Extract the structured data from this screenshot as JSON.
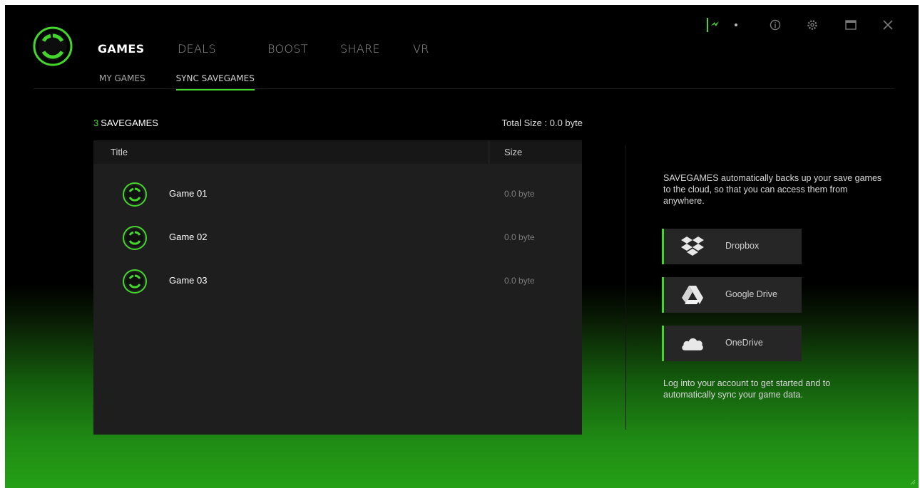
{
  "nav": {
    "tabs": [
      {
        "label": "GAMES",
        "active": true
      },
      {
        "label": "DEALS",
        "active": false
      },
      {
        "label": "BOOST",
        "active": false
      },
      {
        "label": "SHARE",
        "active": false
      },
      {
        "label": "VR",
        "active": false
      }
    ],
    "subtabs": [
      {
        "label": "MY GAMES",
        "active": false
      },
      {
        "label": "SYNC SAVEGAMES",
        "active": true
      }
    ]
  },
  "window_controls": {
    "icons": [
      "razer-snake-icon",
      "dropdown-dot-icon",
      "info-icon",
      "gear-icon",
      "maximize-icon",
      "close-icon"
    ]
  },
  "list": {
    "count": "3",
    "heading": "SAVEGAMES",
    "total_size": "Total Size : 0.0 byte",
    "columns": {
      "title": "Title",
      "size": "Size"
    },
    "rows": [
      {
        "name": "Game 01",
        "size": "0.0 byte"
      },
      {
        "name": "Game 02",
        "size": "0.0 byte"
      },
      {
        "name": "Game 03",
        "size": "0.0 byte"
      }
    ]
  },
  "side_panel": {
    "intro": "SAVEGAMES automatically backs up your save games to the cloud, so that you can access them from anywhere.",
    "providers": [
      {
        "label": "Dropbox",
        "icon": "dropbox-icon"
      },
      {
        "label": "Google Drive",
        "icon": "google-drive-icon"
      },
      {
        "label": "OneDrive",
        "icon": "onedrive-icon"
      }
    ],
    "footer": "Log into your account to get started and to automatically sync your game data."
  },
  "colors": {
    "accent": "#44d62c",
    "panel": "#1e1e1e",
    "header": "#171717",
    "button": "#262626"
  }
}
